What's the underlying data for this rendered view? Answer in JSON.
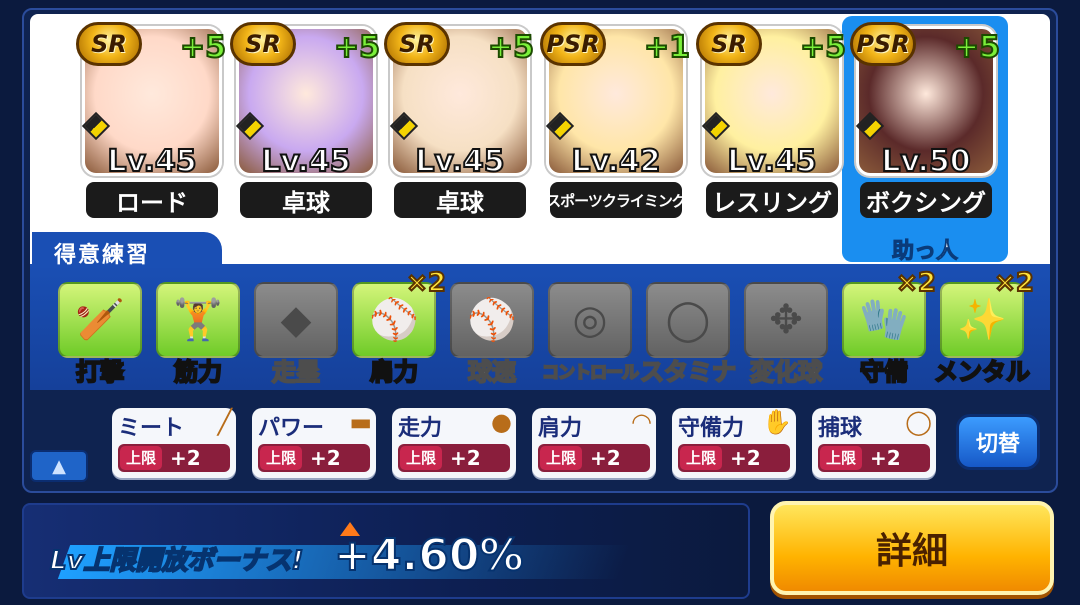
{
  "deck": [
    {
      "rarity": "SR",
      "plus": "+5",
      "level": "Lv.45",
      "name": "ロード",
      "bg": "#ffd9c8"
    },
    {
      "rarity": "SR",
      "plus": "+5",
      "level": "Lv.45",
      "name": "卓球",
      "bg": "#c9a9f0"
    },
    {
      "rarity": "SR",
      "plus": "+5",
      "level": "Lv.45",
      "name": "卓球",
      "bg": "#f6e0c4"
    },
    {
      "rarity": "PSR",
      "plus": "+1",
      "level": "Lv.42",
      "name": "スポーツクライミング",
      "bg": "#ffe6a8"
    },
    {
      "rarity": "SR",
      "plus": "+5",
      "level": "Lv.45",
      "name": "レスリング",
      "bg": "#fff0a0"
    },
    {
      "rarity": "PSR",
      "plus": "+5",
      "level": "Lv.50",
      "name": "ボクシング",
      "bg": "#5b2a2a"
    }
  ],
  "helper_label": "助っ人",
  "practice_title": "得意練習",
  "practices": [
    {
      "label": "打撃",
      "active": true,
      "mult": "",
      "icon": "bat-icon",
      "glyph": "🏏"
    },
    {
      "label": "筋力",
      "active": true,
      "mult": "",
      "icon": "dumbbell-icon",
      "glyph": "🏋"
    },
    {
      "label": "走塁",
      "active": false,
      "mult": "",
      "icon": "base-icon",
      "glyph": "◆"
    },
    {
      "label": "肩力",
      "active": true,
      "mult": "×2",
      "icon": "throw-ball-icon",
      "glyph": "⚾"
    },
    {
      "label": "球速",
      "active": false,
      "mult": "",
      "icon": "fastball-icon",
      "glyph": "⚾"
    },
    {
      "label": "コントロール",
      "active": false,
      "mult": "",
      "icon": "target-icon",
      "glyph": "◎"
    },
    {
      "label": "スタミナ",
      "active": false,
      "mult": "",
      "icon": "tire-icon",
      "glyph": "◯"
    },
    {
      "label": "変化球",
      "active": false,
      "mult": "",
      "icon": "breaking-ball-icon",
      "glyph": "✥"
    },
    {
      "label": "守備",
      "active": true,
      "mult": "×2",
      "icon": "glove-icon",
      "glyph": "🧤"
    },
    {
      "label": "メンタル",
      "active": true,
      "mult": "×2",
      "icon": "sparkle-icon",
      "glyph": "✨"
    }
  ],
  "bonuses": [
    {
      "name": "ミート",
      "cap": "上限",
      "value": "+2",
      "icon": "bat-icon",
      "glyph": "╱"
    },
    {
      "name": "パワー",
      "cap": "上限",
      "value": "+2",
      "icon": "dumbbell-icon",
      "glyph": "▬"
    },
    {
      "name": "走力",
      "cap": "上限",
      "value": "+2",
      "icon": "runner-icon",
      "glyph": "●"
    },
    {
      "name": "肩力",
      "cap": "上限",
      "value": "+2",
      "icon": "throw-ball-icon",
      "glyph": "◠"
    },
    {
      "name": "守備力",
      "cap": "上限",
      "value": "+2",
      "icon": "glove-icon",
      "glyph": "✋"
    },
    {
      "name": "捕球",
      "cap": "上限",
      "value": "+2",
      "icon": "catch-ball-icon",
      "glyph": "◯"
    }
  ],
  "switch_label": "切替",
  "collapse_icon": "▲",
  "lv_bonus_label": "Lv上限開放ボーナス!",
  "lv_bonus_value": "+4.60%",
  "detail_label": "詳細"
}
